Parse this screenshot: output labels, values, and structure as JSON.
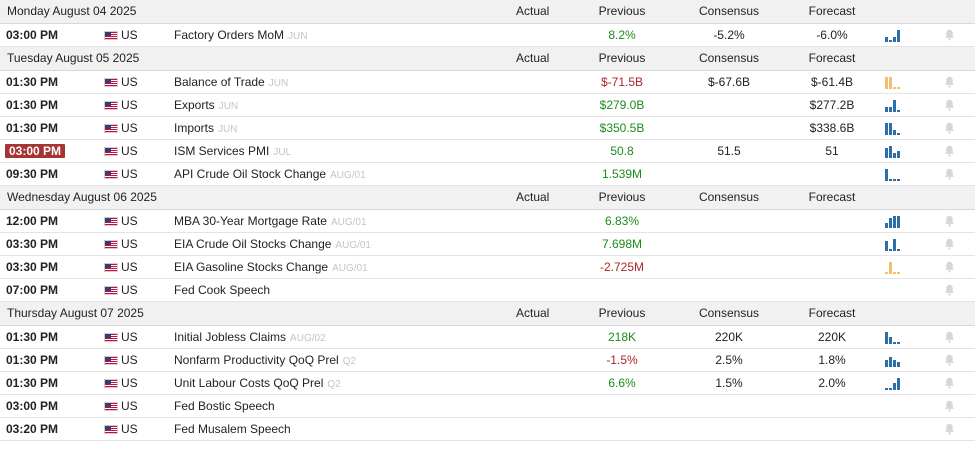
{
  "columns": {
    "actual": "Actual",
    "previous": "Previous",
    "consensus": "Consensus",
    "forecast": "Forecast"
  },
  "days": [
    {
      "date": "Monday August 04 2025",
      "events": [
        {
          "time": "03:00 PM",
          "country": "US",
          "name": "Factory Orders MoM",
          "ref": "JUN",
          "actual": "",
          "previous": "8.2%",
          "prev_tone": "pos",
          "consensus": "-5.2%",
          "forecast": "-6.0%",
          "spark": [
            2,
            1,
            2,
            5
          ],
          "spark_tone": "down"
        }
      ]
    },
    {
      "date": "Tuesday August 05 2025",
      "events": [
        {
          "time": "01:30 PM",
          "country": "US",
          "name": "Balance of Trade",
          "ref": "JUN",
          "actual": "",
          "previous": "$-71.5B",
          "prev_tone": "neg",
          "consensus": "$-67.6B",
          "forecast": "$-61.4B",
          "spark": [
            5,
            5,
            1,
            1
          ],
          "spark_tone": "up"
        },
        {
          "time": "01:30 PM",
          "country": "US",
          "name": "Exports",
          "ref": "JUN",
          "actual": "",
          "previous": "$279.0B",
          "prev_tone": "pos",
          "consensus": "",
          "forecast": "$277.2B",
          "spark": [
            2,
            2,
            5,
            1
          ],
          "spark_tone": "down"
        },
        {
          "time": "01:30 PM",
          "country": "US",
          "name": "Imports",
          "ref": "JUN",
          "actual": "",
          "previous": "$350.5B",
          "prev_tone": "pos",
          "consensus": "",
          "forecast": "$338.6B",
          "spark": [
            5,
            5,
            2,
            1
          ],
          "spark_tone": "down"
        },
        {
          "time": "03:00 PM",
          "country": "US",
          "name": "ISM Services PMI",
          "ref": "JUL",
          "actual": "",
          "previous": "50.8",
          "prev_tone": "pos",
          "consensus": "51.5",
          "forecast": "51",
          "spark": [
            4,
            5,
            2,
            3
          ],
          "spark_tone": "down",
          "highlight": true
        },
        {
          "time": "09:30 PM",
          "country": "US",
          "name": "API Crude Oil Stock Change",
          "ref": "AUG/01",
          "actual": "",
          "previous": "1.539M",
          "prev_tone": "pos",
          "consensus": "",
          "forecast": "",
          "spark": [
            5,
            1,
            1,
            1
          ],
          "spark_tone": "down"
        }
      ]
    },
    {
      "date": "Wednesday August 06 2025",
      "events": [
        {
          "time": "12:00 PM",
          "country": "US",
          "name": "MBA 30-Year Mortgage Rate",
          "ref": "AUG/01",
          "actual": "",
          "previous": "6.83%",
          "prev_tone": "pos",
          "consensus": "",
          "forecast": "",
          "spark": [
            2,
            4,
            5,
            5
          ],
          "spark_tone": "down"
        },
        {
          "time": "03:30 PM",
          "country": "US",
          "name": "EIA Crude Oil Stocks Change",
          "ref": "AUG/01",
          "actual": "",
          "previous": "7.698M",
          "prev_tone": "pos",
          "consensus": "",
          "forecast": "",
          "spark": [
            4,
            1,
            5,
            1
          ],
          "spark_tone": "down"
        },
        {
          "time": "03:30 PM",
          "country": "US",
          "name": "EIA Gasoline Stocks Change",
          "ref": "AUG/01",
          "actual": "",
          "previous": "-2.725M",
          "prev_tone": "neg",
          "consensus": "",
          "forecast": "",
          "spark": [
            1,
            5,
            1,
            1
          ],
          "spark_tone": "up"
        },
        {
          "time": "07:00 PM",
          "country": "US",
          "name": "Fed Cook Speech",
          "ref": "",
          "actual": "",
          "previous": "",
          "prev_tone": "",
          "consensus": "",
          "forecast": "",
          "spark": [],
          "spark_tone": ""
        }
      ]
    },
    {
      "date": "Thursday August 07 2025",
      "events": [
        {
          "time": "01:30 PM",
          "country": "US",
          "name": "Initial Jobless Claims",
          "ref": "AUG/02",
          "actual": "",
          "previous": "218K",
          "prev_tone": "pos",
          "consensus": "220K",
          "forecast": "220K",
          "spark": [
            5,
            3,
            1,
            1
          ],
          "spark_tone": "down"
        },
        {
          "time": "01:30 PM",
          "country": "US",
          "name": "Nonfarm Productivity QoQ Prel",
          "ref": "Q2",
          "actual": "",
          "previous": "-1.5%",
          "prev_tone": "neg",
          "consensus": "2.5%",
          "forecast": "1.8%",
          "spark": [
            3,
            4,
            3,
            2
          ],
          "spark_tone": "down"
        },
        {
          "time": "01:30 PM",
          "country": "US",
          "name": "Unit Labour Costs QoQ Prel",
          "ref": "Q2",
          "actual": "",
          "previous": "6.6%",
          "prev_tone": "pos",
          "consensus": "1.5%",
          "forecast": "2.0%",
          "spark": [
            1,
            1,
            3,
            5
          ],
          "spark_tone": "down"
        },
        {
          "time": "03:00 PM",
          "country": "US",
          "name": "Fed Bostic Speech",
          "ref": "",
          "actual": "",
          "previous": "",
          "prev_tone": "",
          "consensus": "",
          "forecast": "",
          "spark": [],
          "spark_tone": ""
        },
        {
          "time": "03:20 PM",
          "country": "US",
          "name": "Fed Musalem Speech",
          "ref": "",
          "actual": "",
          "previous": "",
          "prev_tone": "",
          "consensus": "",
          "forecast": "",
          "spark": [],
          "spark_tone": ""
        }
      ]
    }
  ],
  "colors": {
    "positive": "#1b8c1b",
    "negative": "#b02424",
    "spark": "#2c6ea8",
    "highlight": "#a63434"
  },
  "icons": {
    "flag": "us-flag-icon",
    "bell": "bell-icon"
  }
}
